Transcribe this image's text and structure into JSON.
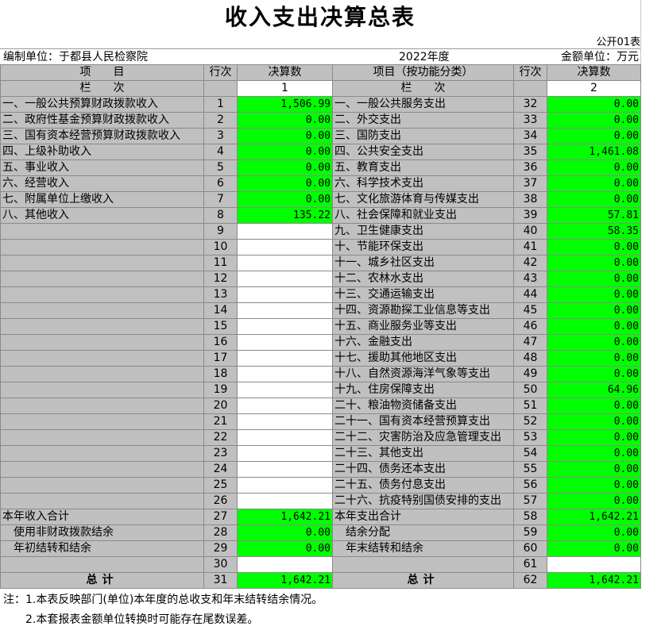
{
  "title": "收入支出决算总表",
  "form_no": "公开01表",
  "unit": "编制单位：于都县人民检察院",
  "year": "2022年度",
  "money_unit": "金额单位：万元",
  "header": {
    "item": "项　　目",
    "row": "行次",
    "amount": "决算数",
    "item2": "项目（按功能分类）",
    "row2": "行次",
    "amount2": "决算数",
    "col": "栏　　次",
    "col1": "1",
    "col_right": "栏　　次",
    "col2": "2"
  },
  "rows": [
    {
      "l": "一、一般公共预算财政拨款收入",
      "ln": "1",
      "lv": "1,506.99",
      "r": "一、一般公共服务支出",
      "rn": "32",
      "rv": "0.00"
    },
    {
      "l": "二、政府性基金预算财政拨款收入",
      "ln": "2",
      "lv": "0.00",
      "r": "二、外交支出",
      "rn": "33",
      "rv": "0.00"
    },
    {
      "l": "三、国有资本经营预算财政拨款收入",
      "ln": "3",
      "lv": "0.00",
      "r": "三、国防支出",
      "rn": "34",
      "rv": "0.00"
    },
    {
      "l": "四、上级补助收入",
      "ln": "4",
      "lv": "0.00",
      "r": "四、公共安全支出",
      "rn": "35",
      "rv": "1,461.08"
    },
    {
      "l": "五、事业收入",
      "ln": "5",
      "lv": "0.00",
      "r": "五、教育支出",
      "rn": "36",
      "rv": "0.00"
    },
    {
      "l": "六、经营收入",
      "ln": "6",
      "lv": "0.00",
      "r": "六、科学技术支出",
      "rn": "37",
      "rv": "0.00"
    },
    {
      "l": "七、附属单位上缴收入",
      "ln": "7",
      "lv": "0.00",
      "r": "七、文化旅游体育与传媒支出",
      "rn": "38",
      "rv": "0.00"
    },
    {
      "l": "八、其他收入",
      "ln": "8",
      "lv": "135.22",
      "r": "八、社会保障和就业支出",
      "rn": "39",
      "rv": "57.81"
    },
    {
      "l": "",
      "ln": "9",
      "lv": "",
      "r": "九、卫生健康支出",
      "rn": "40",
      "rv": "58.35"
    },
    {
      "l": "",
      "ln": "10",
      "lv": "",
      "r": "十、节能环保支出",
      "rn": "41",
      "rv": "0.00"
    },
    {
      "l": "",
      "ln": "11",
      "lv": "",
      "r": "十一、城乡社区支出",
      "rn": "42",
      "rv": "0.00"
    },
    {
      "l": "",
      "ln": "12",
      "lv": "",
      "r": "十二、农林水支出",
      "rn": "43",
      "rv": "0.00"
    },
    {
      "l": "",
      "ln": "13",
      "lv": "",
      "r": "十三、交通运输支出",
      "rn": "44",
      "rv": "0.00"
    },
    {
      "l": "",
      "ln": "14",
      "lv": "",
      "r": "十四、资源勘探工业信息等支出",
      "rn": "45",
      "rv": "0.00"
    },
    {
      "l": "",
      "ln": "15",
      "lv": "",
      "r": "十五、商业服务业等支出",
      "rn": "46",
      "rv": "0.00"
    },
    {
      "l": "",
      "ln": "16",
      "lv": "",
      "r": "十六、金融支出",
      "rn": "47",
      "rv": "0.00"
    },
    {
      "l": "",
      "ln": "17",
      "lv": "",
      "r": "十七、援助其他地区支出",
      "rn": "48",
      "rv": "0.00"
    },
    {
      "l": "",
      "ln": "18",
      "lv": "",
      "r": "十八、自然资源海洋气象等支出",
      "rn": "49",
      "rv": "0.00"
    },
    {
      "l": "",
      "ln": "19",
      "lv": "",
      "r": "十九、住房保障支出",
      "rn": "50",
      "rv": "64.96"
    },
    {
      "l": "",
      "ln": "20",
      "lv": "",
      "r": "二十、粮油物资储备支出",
      "rn": "51",
      "rv": "0.00"
    },
    {
      "l": "",
      "ln": "21",
      "lv": "",
      "r": "二十一、国有资本经营预算支出",
      "rn": "52",
      "rv": "0.00"
    },
    {
      "l": "",
      "ln": "22",
      "lv": "",
      "r": "二十二、灾害防治及应急管理支出",
      "rn": "53",
      "rv": "0.00"
    },
    {
      "l": "",
      "ln": "23",
      "lv": "",
      "r": "二十三、其他支出",
      "rn": "54",
      "rv": "0.00"
    },
    {
      "l": "",
      "ln": "24",
      "lv": "",
      "r": "二十四、债务还本支出",
      "rn": "55",
      "rv": "0.00"
    },
    {
      "l": "",
      "ln": "25",
      "lv": "",
      "r": "二十五、债务付息支出",
      "rn": "56",
      "rv": "0.00"
    },
    {
      "l": "",
      "ln": "26",
      "lv": "",
      "r": "二十六、抗疫特别国债安排的支出",
      "rn": "57",
      "rv": "0.00"
    },
    {
      "l": "本年收入合计",
      "ln": "27",
      "lv": "1,642.21",
      "r": "本年支出合计",
      "rn": "58",
      "rv": "1,642.21"
    },
    {
      "l": "　使用非财政拨款结余",
      "ln": "28",
      "lv": "0.00",
      "r": "　结余分配",
      "rn": "59",
      "rv": "0.00"
    },
    {
      "l": "　年初结转和结余",
      "ln": "29",
      "lv": "0.00",
      "r": "　年末结转和结余",
      "rn": "60",
      "rv": "0.00"
    },
    {
      "l": "",
      "ln": "30",
      "lv": "",
      "r": "",
      "rn": "61",
      "rv": ""
    }
  ],
  "total": {
    "l": "总计",
    "ln": "31",
    "lv": "1,642.21",
    "r": "总计",
    "rn": "62",
    "rv": "1,642.21"
  },
  "notes": [
    "注：1.本表反映部门(单位)本年度的总收支和年末结转结余情况。",
    "2.本套报表金额单位转换时可能存在尾数误差。"
  ]
}
